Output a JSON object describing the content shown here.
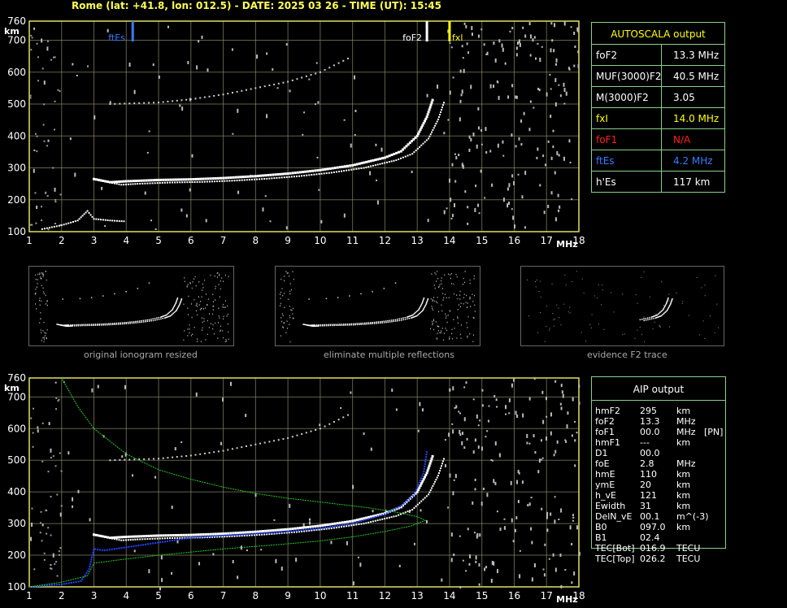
{
  "header": {
    "title": "Rome (lat: +41.8, lon: 012.5) - DATE: 2025 03 26 - TIME (UT): 15:45"
  },
  "axes": {
    "y_unit": "km",
    "x_unit": "MHz",
    "x_ticks": [
      "1",
      "2",
      "3",
      "4",
      "5",
      "6",
      "7",
      "8",
      "9",
      "10",
      "11",
      "12",
      "13",
      "14",
      "15",
      "16",
      "17",
      "18"
    ],
    "y_ticks": [
      "100",
      "200",
      "300",
      "400",
      "500",
      "600",
      "700",
      "760"
    ]
  },
  "markers": {
    "ftEs": "ftEs",
    "foF2": "foF2",
    "fxl": "fxl"
  },
  "autoscala": {
    "title": "AUTOSCALA output",
    "rows": [
      {
        "label": "foF2",
        "value": "13.3 MHz",
        "color": "#ffffff"
      },
      {
        "label": "MUF(3000)F2",
        "value": "40.5 MHz",
        "color": "#ffffff"
      },
      {
        "label": "M(3000)F2",
        "value": "3.05",
        "color": "#ffffff"
      },
      {
        "label": "fxI",
        "value": "14.0 MHz",
        "color": "#ffff00"
      },
      {
        "label": "foF1",
        "value": "N/A",
        "color": "#ff2020"
      },
      {
        "label": "ftEs",
        "value": "4.2 MHz",
        "color": "#3a7bff"
      },
      {
        "label": "h'Es",
        "value": "117    km",
        "color": "#ffffff"
      }
    ]
  },
  "thumbnails": {
    "captions": [
      "original ionogram resized",
      "eliminate multiple reflections",
      "evidence F2 trace"
    ]
  },
  "aip": {
    "title": "AIP output",
    "rows": [
      {
        "name": "hmF2",
        "value": "295",
        "unit": "km",
        "extra": ""
      },
      {
        "name": "foF2",
        "value": "13.3",
        "unit": "MHz",
        "extra": ""
      },
      {
        "name": "foF1",
        "value": "00.0",
        "unit": "MHz",
        "extra": "[PN]"
      },
      {
        "name": "hmF1",
        "value": "---",
        "unit": "km",
        "extra": ""
      },
      {
        "name": "D1",
        "value": "00.0",
        "unit": "",
        "extra": ""
      },
      {
        "name": "foE",
        "value": "2.8",
        "unit": "MHz",
        "extra": ""
      },
      {
        "name": "hmE",
        "value": "110",
        "unit": "km",
        "extra": ""
      },
      {
        "name": "ymE",
        "value": "20",
        "unit": "km",
        "extra": ""
      },
      {
        "name": "h_vE",
        "value": "121",
        "unit": "km",
        "extra": ""
      },
      {
        "name": "Ewidth",
        "value": "31",
        "unit": "km",
        "extra": ""
      },
      {
        "name": "DelN_vE",
        "value": "00.1",
        "unit": "m^(-3)",
        "extra": ""
      },
      {
        "name": "B0",
        "value": "097.0",
        "unit": "km",
        "extra": ""
      },
      {
        "name": "B1",
        "value": "02.4",
        "unit": "",
        "extra": ""
      },
      {
        "name": "TEC[Bot]",
        "value": "016.9",
        "unit": "TECU",
        "extra": ""
      },
      {
        "name": "TEC[Top]",
        "value": "026.2",
        "unit": "TECU",
        "extra": ""
      }
    ]
  },
  "colors": {
    "grid": "#8a8a6a",
    "axis": "#e0e060",
    "trace": "#ffffff",
    "profile": "#22cc22",
    "ftEs": "#3a7bff",
    "fxl": "#ffff00",
    "table_border": "#8ad08a"
  },
  "chart_data": [
    {
      "type": "scatter",
      "xlim": [
        1,
        18
      ],
      "ylim": [
        100,
        760
      ],
      "xlabel": "MHz",
      "ylabel": "km",
      "series": [
        {
          "name": "",
          "points": [
            [
              3.0,
              265
            ],
            [
              3.5,
              255
            ],
            [
              4,
              258
            ],
            [
              5,
              262
            ],
            [
              6,
              264
            ],
            [
              7,
              268
            ],
            [
              8,
              274
            ],
            [
              9,
              282
            ],
            [
              10,
              293
            ],
            [
              11,
              308
            ],
            [
              12,
              332
            ],
            [
              12.5,
              352
            ],
            [
              13,
              400
            ],
            [
              13.3,
              460
            ],
            [
              13.5,
              520
            ]
          ]
        },
        {
          "name": "",
          "points": [
            [
              3.5,
              500
            ],
            [
              5,
              505
            ],
            [
              6,
              515
            ],
            [
              7,
              530
            ],
            [
              8,
              550
            ],
            [
              9,
              570
            ],
            [
              10,
              600
            ],
            [
              11,
              650
            ]
          ]
        },
        {
          "name": "",
          "points": [
            [
              1.4,
              108
            ],
            [
              2,
              120
            ],
            [
              2.5,
              135
            ],
            [
              2.8,
              165
            ],
            [
              3.0,
              140
            ],
            [
              3.5,
              135
            ],
            [
              4,
              132
            ]
          ]
        }
      ],
      "markers": [
        {
          "label": "ftEs",
          "x": 4.2
        },
        {
          "label": "foF2",
          "x": 13.3
        },
        {
          "label": "fxl",
          "x": 14.0
        }
      ]
    },
    {
      "type": "line",
      "xlim": [
        1,
        18
      ],
      "ylim": [
        100,
        760
      ],
      "xlabel": "MHz",
      "ylabel": "km",
      "series": [
        {
          "name": "",
          "points": [
            [
              3.0,
              265
            ],
            [
              3.5,
              255
            ],
            [
              4,
              258
            ],
            [
              5,
              262
            ],
            [
              6,
              264
            ],
            [
              7,
              268
            ],
            [
              8,
              274
            ],
            [
              9,
              282
            ],
            [
              10,
              293
            ],
            [
              11,
              308
            ],
            [
              12,
              332
            ],
            [
              12.5,
              352
            ],
            [
              13,
              400
            ],
            [
              13.3,
              460
            ],
            [
              13.5,
              520
            ]
          ]
        },
        {
          "name": "",
          "points": [
            [
              3.5,
              500
            ],
            [
              5,
              505
            ],
            [
              6,
              515
            ],
            [
              7,
              530
            ],
            [
              8,
              550
            ],
            [
              9,
              570
            ],
            [
              10,
              600
            ],
            [
              11,
              650
            ]
          ]
        },
        {
          "name": "",
          "points": [
            [
              1,
              100
            ],
            [
              2,
              108
            ],
            [
              2.6,
              118
            ],
            [
              2.85,
              155
            ],
            [
              3.0,
              220
            ],
            [
              3.3,
              215
            ],
            [
              4,
              225
            ],
            [
              5,
              240
            ],
            [
              6,
              255
            ],
            [
              7,
              262
            ],
            [
              8,
              268
            ],
            [
              9,
              275
            ],
            [
              10,
              285
            ],
            [
              11,
              300
            ],
            [
              12,
              330
            ],
            [
              12.5,
              355
            ],
            [
              12.9,
              390
            ],
            [
              13.2,
              460
            ],
            [
              13.3,
              530
            ]
          ]
        },
        {
          "name": "",
          "points": [
            [
              1,
              100
            ],
            [
              2,
              115
            ],
            [
              2.8,
              135
            ],
            [
              3,
              175
            ],
            [
              4,
              188
            ],
            [
              5,
              200
            ],
            [
              6,
              210
            ],
            [
              7,
              220
            ],
            [
              8,
              228
            ],
            [
              9,
              236
            ],
            [
              10,
              245
            ],
            [
              11,
              258
            ],
            [
              12,
              275
            ],
            [
              12.8,
              292
            ],
            [
              13.25,
              310
            ],
            [
              13.0,
              322
            ],
            [
              12.4,
              335
            ],
            [
              11.5,
              350
            ],
            [
              10,
              368
            ],
            [
              9,
              380
            ],
            [
              8,
              395
            ],
            [
              7,
              415
            ],
            [
              6,
              440
            ],
            [
              5,
              470
            ],
            [
              4,
              520
            ],
            [
              3,
              600
            ],
            [
              2.5,
              670
            ],
            [
              2.0,
              760
            ]
          ]
        }
      ]
    }
  ]
}
